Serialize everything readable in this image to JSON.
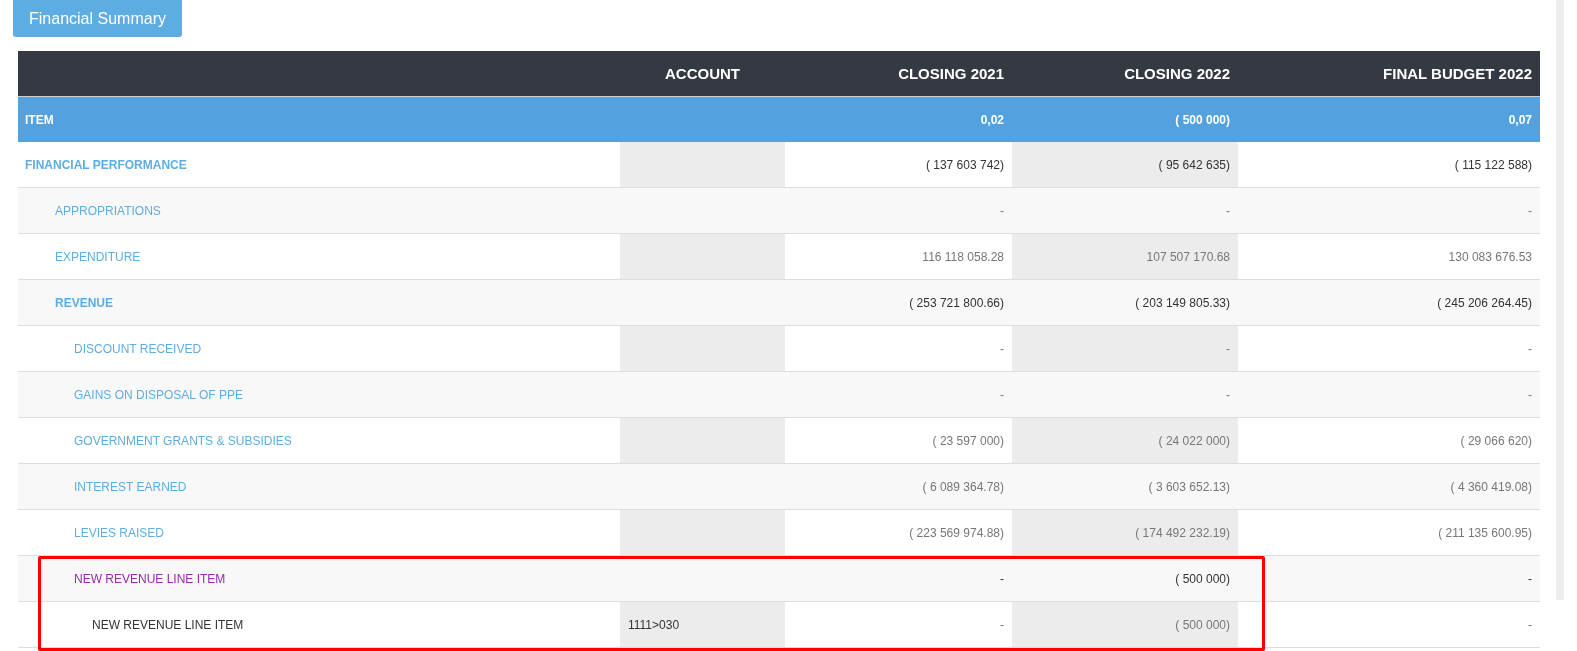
{
  "button": {
    "label": "Financial Summary"
  },
  "table": {
    "columns": [
      "",
      "ACCOUNT",
      "CLOSING 2021",
      "CLOSING 2022",
      "FINAL BUDGET 2022"
    ],
    "summary_row": {
      "label": "ITEM",
      "closing_2021": "0,02",
      "closing_2022": "( 500 000)",
      "final_budget_2022": "0,07"
    },
    "rows": [
      {
        "kind": "group",
        "label": "FINANCIAL PERFORMANCE",
        "closing_2021": "( 137 603 742)",
        "closing_2022": "( 95 642 635)",
        "final_budget_2022": "( 115 122 588)",
        "highlighted": false,
        "children": [
          {
            "kind": "item",
            "label": "APPROPRIATIONS",
            "closing_2021": "-",
            "closing_2022": "-",
            "final_budget_2022": "-",
            "highlighted": false
          },
          {
            "kind": "item",
            "label": "EXPENDITURE",
            "closing_2021": "116 118 058.28",
            "closing_2022": "107 507 170.68",
            "final_budget_2022": "130 083 676.53",
            "highlighted": false
          },
          {
            "kind": "group",
            "label": "REVENUE",
            "closing_2021": "( 253 721 800.66)",
            "closing_2022": "( 203 149 805.33)",
            "final_budget_2022": "( 245 206 264.45)",
            "highlighted": false,
            "children": [
              {
                "kind": "item",
                "label": "DISCOUNT RECEIVED",
                "closing_2021": "-",
                "closing_2022": "-",
                "final_budget_2022": "-",
                "highlighted": false
              },
              {
                "kind": "item",
                "label": "GAINS ON DISPOSAL OF PPE",
                "closing_2021": "-",
                "closing_2022": "-",
                "final_budget_2022": "-",
                "highlighted": false
              },
              {
                "kind": "item",
                "label": "GOVERNMENT GRANTS & SUBSIDIES",
                "closing_2021": "( 23 597 000)",
                "closing_2022": "( 24 022 000)",
                "final_budget_2022": "( 29 066 620)",
                "highlighted": false
              },
              {
                "kind": "item",
                "label": "INTEREST EARNED",
                "closing_2021": "( 6 089 364.78)",
                "closing_2022": "( 3 603 652.13)",
                "final_budget_2022": "( 4 360 419.08)",
                "highlighted": false
              },
              {
                "kind": "item",
                "label": "LEVIES RAISED",
                "closing_2021": "( 223 569 974.88)",
                "closing_2022": "( 174 492 232.19)",
                "final_budget_2022": "( 211 135 600.95)",
                "highlighted": false
              },
              {
                "kind": "new",
                "label": "NEW REVENUE LINE ITEM",
                "closing_2021": "-",
                "closing_2022": "( 500 000)",
                "final_budget_2022": "-",
                "highlighted": true,
                "children": [
                  {
                    "kind": "account",
                    "label": "NEW REVENUE LINE ITEM",
                    "account": "1111>030",
                    "closing_2021": "-",
                    "closing_2022": "( 500 000)",
                    "final_budget_2022": "-",
                    "highlighted": false
                  }
                ]
              }
            ]
          }
        ]
      }
    ]
  }
}
